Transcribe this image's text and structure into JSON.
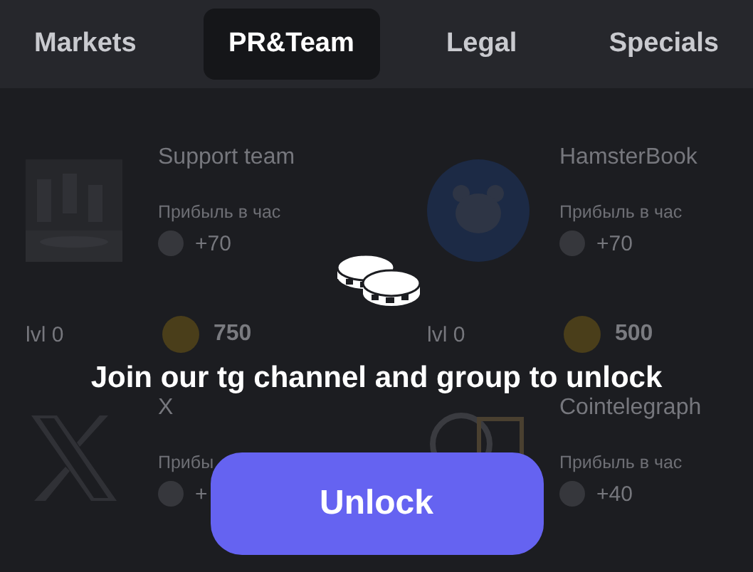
{
  "tabs": [
    {
      "label": "Markets",
      "selected": false
    },
    {
      "label": "PR&Team",
      "selected": true
    },
    {
      "label": "Legal",
      "selected": false
    },
    {
      "label": "Specials",
      "selected": false
    }
  ],
  "cards": [
    {
      "title": "Support team",
      "kind": "picture",
      "profit_label": "Прибыль в час",
      "profit": "+70",
      "level": "lvl 0",
      "price": "750"
    },
    {
      "title": "HamsterBook",
      "kind": "hamster",
      "profit_label": "Прибыль в час",
      "profit": "+70",
      "level": "lvl 0",
      "price": "500"
    },
    {
      "title": "X",
      "kind": "x",
      "profit_label": "Прибы",
      "profit": "+"
    },
    {
      "title": "Cointelegraph",
      "kind": "ring",
      "profit_label": "Прибыль в час",
      "profit": "+40"
    }
  ],
  "overlay": {
    "message": "Join our tg channel and group to unlock",
    "button": "Unlock"
  }
}
